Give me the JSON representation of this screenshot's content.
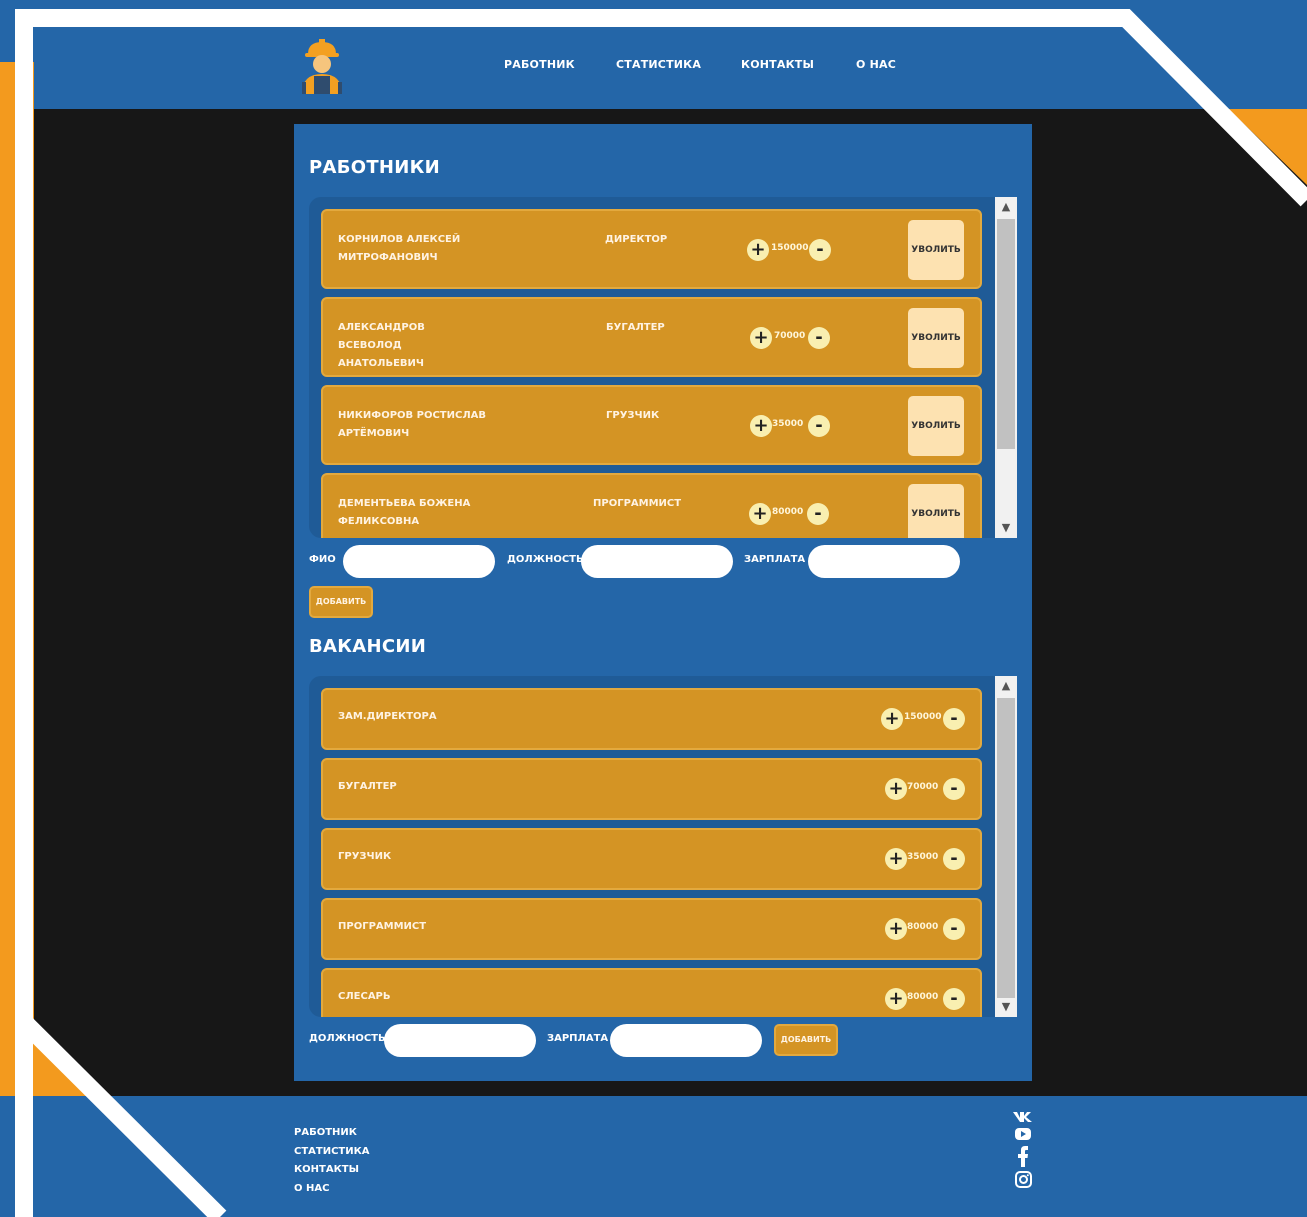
{
  "header": {
    "nav": [
      "работник",
      "статистика",
      "контакты",
      "о нас"
    ]
  },
  "workers": {
    "title": "работники",
    "rows": [
      {
        "name": "корнилов алексей митрофанович",
        "role": "директор",
        "salary": "150000",
        "fire": "уволить"
      },
      {
        "name": "александров всеволод анатольевич",
        "role": "бугалтер",
        "salary": "70000",
        "fire": "уволить"
      },
      {
        "name": "никифоров ростислав артёмович",
        "role": "грузчик",
        "salary": "35000",
        "fire": "уволить"
      },
      {
        "name": "дементьева божена феликсовна",
        "role": "программист",
        "salary": "80000",
        "fire": "уволить"
      }
    ],
    "form": {
      "fio_label": "фио",
      "position_label": "должность",
      "salary_label": "зарплата",
      "add_label": "добавить"
    }
  },
  "vacancies": {
    "title": "вакансии",
    "rows": [
      {
        "name": "зам.директора",
        "salary": "150000"
      },
      {
        "name": "бугалтер",
        "salary": "70000"
      },
      {
        "name": "грузчик",
        "salary": "35000"
      },
      {
        "name": "программист",
        "salary": "80000"
      },
      {
        "name": "слесарь",
        "salary": "80000"
      }
    ],
    "form": {
      "position_label": "должность",
      "salary_label": "зарплата",
      "add_label": "добавить"
    }
  },
  "footer": {
    "links": [
      "работник",
      "статистика",
      "контакты",
      "о нас"
    ],
    "social": [
      "vk-icon",
      "youtube-icon",
      "facebook-icon",
      "instagram-icon"
    ]
  },
  "colors": {
    "blue": "#2466a8",
    "orange": "#d49424",
    "accent_orange": "#f39a1e",
    "dark": "#171717"
  }
}
